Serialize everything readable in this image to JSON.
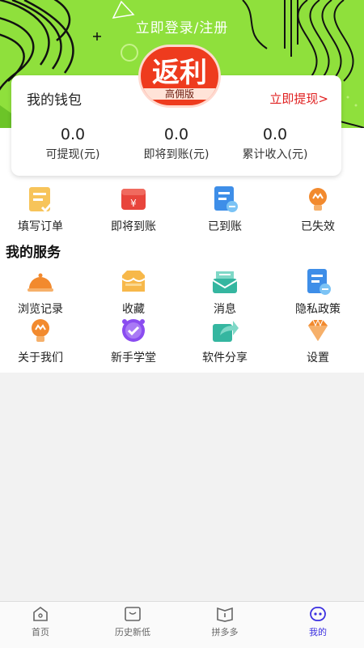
{
  "header": {
    "login_label": "立即登录/注册",
    "bg_color": "#8fe03c",
    "logo_text": "返利",
    "logo_sub": "高佣版",
    "logo_color": "#ee3b1e"
  },
  "wallet": {
    "title": "我的钱包",
    "withdraw_label": "立即提现>",
    "stats": [
      {
        "value": "0.0",
        "label": "可提现(元)"
      },
      {
        "value": "0.0",
        "label": "即将到账(元)"
      },
      {
        "value": "0.0",
        "label": "累计收入(元)"
      }
    ]
  },
  "orders": [
    {
      "label": "填写订单",
      "icon": "fill-order-icon"
    },
    {
      "label": "即将到账",
      "icon": "pending-arrival-icon"
    },
    {
      "label": "已到账",
      "icon": "arrived-icon"
    },
    {
      "label": "已失效",
      "icon": "expired-icon"
    }
  ],
  "services": {
    "title": "我的服务",
    "items": [
      {
        "label": "浏览记录",
        "icon": "history-icon"
      },
      {
        "label": "收藏",
        "icon": "favorites-icon"
      },
      {
        "label": "消息",
        "icon": "message-icon"
      },
      {
        "label": "隐私政策",
        "icon": "privacy-policy-icon"
      },
      {
        "label": "关于我们",
        "icon": "about-us-icon"
      },
      {
        "label": "新手学堂",
        "icon": "tutorial-icon"
      },
      {
        "label": "软件分享",
        "icon": "share-icon"
      },
      {
        "label": "设置",
        "icon": "settings-icon"
      }
    ]
  },
  "bottom_nav": {
    "items": [
      {
        "label": "首页",
        "icon": "home-icon"
      },
      {
        "label": "历史新低",
        "icon": "history-low-icon"
      },
      {
        "label": "拼多多",
        "icon": "pinduoduo-icon"
      },
      {
        "label": "我的",
        "icon": "profile-icon",
        "active": true
      }
    ],
    "active_color": "#3b2fe0"
  },
  "colors": {
    "accent_red": "#e02020",
    "icon_yellow": "#f7b84a",
    "icon_red": "#e8453c",
    "icon_blue": "#3e8ee8",
    "icon_orange": "#f28a2e",
    "icon_teal": "#35b6a0",
    "icon_purple": "#8a4cf0"
  }
}
